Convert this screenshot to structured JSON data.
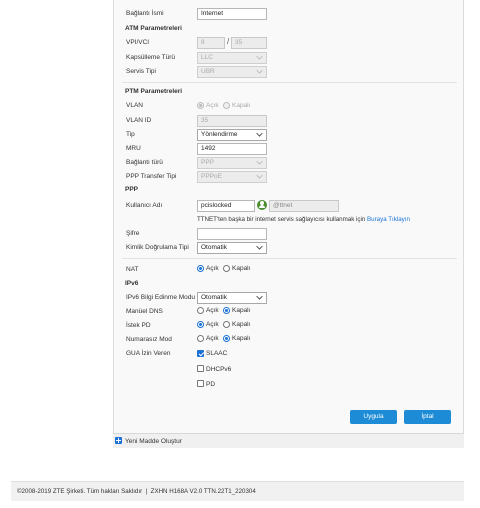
{
  "form": {
    "connection_name": {
      "label": "Bağlantı İsmi",
      "value": "Internet"
    },
    "atm": {
      "title": "ATM Parametreleri",
      "vpi_vci": {
        "label": "VPI/VCI",
        "vpi": "8",
        "vci": "35"
      },
      "encapsulation": {
        "label": "Kapsülleme Türü",
        "value": "LLC"
      },
      "service_type": {
        "label": "Servis Tipi",
        "value": "UBR"
      }
    },
    "ptm": {
      "title": "PTM Parametreleri",
      "vlan": {
        "label": "VLAN",
        "on": "Açık",
        "off": "Kapalı"
      },
      "vlan_id": {
        "label": "VLAN ID",
        "value": "35"
      },
      "type": {
        "label": "Tip",
        "value": "Yönlendirme"
      },
      "mru": {
        "label": "MRU",
        "value": "1492"
      },
      "connection_type": {
        "label": "Bağlantı türü",
        "value": "PPP"
      },
      "ppp_transfer": {
        "label": "PPP Transfer Tipi",
        "value": "PPPoE"
      }
    },
    "ppp": {
      "title": "PPP",
      "username": {
        "label": "Kullanıcı Adı",
        "value": "pcislocked",
        "suffix": "@ttnet"
      },
      "note_text": "TTNET'ten başka bir internet servis sağlayıcısı kullanmak için",
      "note_link": "Buraya Tıklayın",
      "password": {
        "label": "Şifre",
        "value": ""
      },
      "auth": {
        "label": "Kimlik Doğrulama Tipi",
        "value": "Otomatik"
      }
    },
    "nat": {
      "label": "NAT",
      "on": "Açık",
      "off": "Kapalı"
    },
    "ipv6": {
      "title": "IPv6",
      "info_mode": {
        "label": "IPv6 Bilgi Edinme Modu",
        "value": "Otomatik"
      },
      "manual_dns": {
        "label": "Manüel DNS",
        "on": "Açık",
        "off": "Kapalı"
      },
      "request_pd": {
        "label": "İstek PD",
        "on": "Açık",
        "off": "Kapalı"
      },
      "unnumbered": {
        "label": "Numarasız Mod",
        "on": "Açık",
        "off": "Kapalı"
      },
      "gua": {
        "label": "GUA İzin Veren",
        "slaac": "SLAAC",
        "dhcpv6": "DHCPv6",
        "pd": "PD"
      }
    },
    "buttons": {
      "apply": "Uygula",
      "cancel": "İptal"
    },
    "new_item": "Yeni Madde Oluştur"
  },
  "footer": {
    "copyright": "©2008-2019 ZTE Şirketi. Tüm hakları Saklıdır",
    "separator": "|",
    "version": "ZXHN H168A V2.0 TTN.22T1_220304"
  },
  "colors": {
    "accent": "#1e8bd6",
    "panel_bg": "#f9f9f9"
  }
}
